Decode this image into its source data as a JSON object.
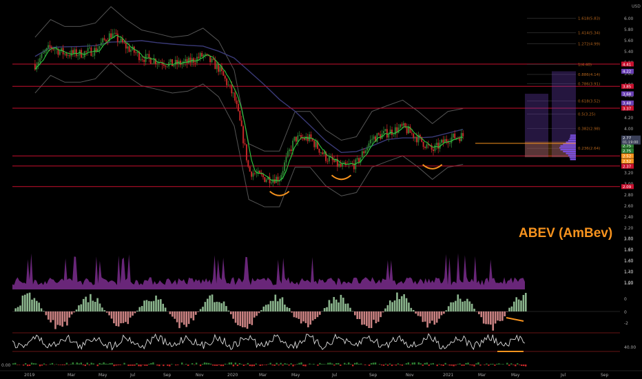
{
  "chart_data": {
    "type": "line",
    "title": "ABEV (AmBev)",
    "currency_label": "USD",
    "colors": {
      "background": "#000000",
      "price_up": "#2e7d32",
      "price_down": "#c62828",
      "ma_fast": "#2ecc40",
      "ma_slow": "#3a3a78",
      "bands": "#555555",
      "resistance": "#c8102e",
      "accent": "#f7931e",
      "volume": "#7b2d8e",
      "fib": "#b5651d"
    },
    "x_axis": {
      "ticks": [
        "2019",
        "Mar",
        "May",
        "Jul",
        "Sep",
        "Nov",
        "2020",
        "Mar",
        "May",
        "Jul",
        "Sep",
        "Nov",
        "2021",
        "Mar",
        "May",
        "Jul",
        "Sep"
      ]
    },
    "y_axis": {
      "scale": "log",
      "range": [
        1.55,
        6.3
      ],
      "ticks": [
        "6.00",
        "5.80",
        "5.60",
        "5.40",
        "5.20",
        "5.00",
        "4.80",
        "4.60",
        "4.40",
        "4.20",
        "4.00",
        "3.80",
        "3.60",
        "3.40",
        "3.20",
        "3.00",
        "2.80",
        "2.60",
        "2.40",
        "2.20",
        "2.00",
        "1.80",
        "1.60",
        "1.40",
        "1.20",
        "1.00"
      ]
    },
    "price_series": {
      "name": "ABEV",
      "x": [
        "2019-01",
        "2019-02",
        "2019-03",
        "2019-04",
        "2019-05",
        "2019-06",
        "2019-07",
        "2019-08",
        "2019-09",
        "2019-10",
        "2019-11",
        "2019-12",
        "2020-01",
        "2020-02",
        "2020-03",
        "2020-04",
        "2020-05",
        "2020-06",
        "2020-07",
        "2020-08",
        "2020-09",
        "2020-10",
        "2020-11",
        "2020-12",
        "2021-01",
        "2021-02",
        "2021-03",
        "2021-04",
        "2021-05"
      ],
      "y": [
        4.4,
        4.9,
        4.7,
        4.7,
        4.8,
        5.3,
        4.9,
        4.6,
        4.5,
        4.4,
        4.45,
        4.65,
        4.3,
        3.6,
        2.3,
        2.2,
        2.2,
        2.8,
        2.8,
        2.5,
        2.35,
        2.4,
        2.8,
        2.9,
        3.0,
        2.8,
        2.6,
        2.8,
        2.85
      ]
    },
    "horizontal_levels": [
      {
        "value": 4.41,
        "label": "4.41",
        "color": "#c8102e"
      },
      {
        "value": 3.85,
        "label": "3.85",
        "color": "#c8102e"
      },
      {
        "value": 3.37,
        "label": "3.37",
        "color": "#c8102e"
      },
      {
        "value": 2.52,
        "label": "2.52",
        "color": "#c8102e"
      },
      {
        "value": 2.37,
        "label": "2.37",
        "color": "#c8102e"
      },
      {
        "value": 2.09,
        "label": "2.09",
        "color": "#c8102e"
      }
    ],
    "fibonacci_levels": [
      {
        "value": 5.83,
        "label": "1.618(5.83)"
      },
      {
        "value": 5.34,
        "label": "1.414(5.34)"
      },
      {
        "value": 4.99,
        "label": "1.272(4.99)"
      },
      {
        "value": 4.4,
        "label": "1(4.40)"
      },
      {
        "value": 4.14,
        "label": "0.886(4.14)"
      },
      {
        "value": 3.91,
        "label": "0.786(3.91)"
      },
      {
        "value": 3.52,
        "label": "0.618(3.52)"
      },
      {
        "value": 3.25,
        "label": "0.5(3.25)"
      },
      {
        "value": 2.98,
        "label": "0.382(2.98)"
      },
      {
        "value": 2.64,
        "label": "0.236(2.64)"
      }
    ],
    "price_badges": [
      {
        "value": 4.41,
        "label": "4.41",
        "color": "#c8102e"
      },
      {
        "value": 4.22,
        "label": "4.22",
        "color": "#6a3fb5"
      },
      {
        "value": 3.85,
        "label": "3.85",
        "color": "#c8102e"
      },
      {
        "value": 3.68,
        "label": "3.68",
        "color": "#6a3fb5"
      },
      {
        "value": 3.48,
        "label": "3.48",
        "color": "#6a3fb5"
      },
      {
        "value": 3.37,
        "label": "3.37",
        "color": "#c8102e"
      },
      {
        "value": 2.77,
        "label": "2.77",
        "color": "#2e7d32"
      },
      {
        "value": 2.75,
        "label": "2.75",
        "color": "#2e7d32"
      },
      {
        "value": 2.75,
        "label": "2.75",
        "color": "#2e7d32"
      },
      {
        "value": 2.52,
        "label": "2.52",
        "color": "#f7931e"
      },
      {
        "value": 2.52,
        "label": "2.52",
        "color": "#f7931e"
      },
      {
        "value": 2.37,
        "label": "2.37",
        "color": "#c8102e"
      },
      {
        "value": 2.09,
        "label": "2.09",
        "color": "#c8102e"
      }
    ],
    "last_price_badge": {
      "price": "2.77",
      "countdown": "01:19:00"
    },
    "volume_axis_ticks": [
      "1.00",
      "1.20",
      "1.40",
      "1.60",
      "1.80"
    ],
    "oscillator_ticks": [
      "0",
      "0",
      "-2"
    ],
    "rsi_tick": "40.00",
    "bottom_tick": "0.00"
  }
}
